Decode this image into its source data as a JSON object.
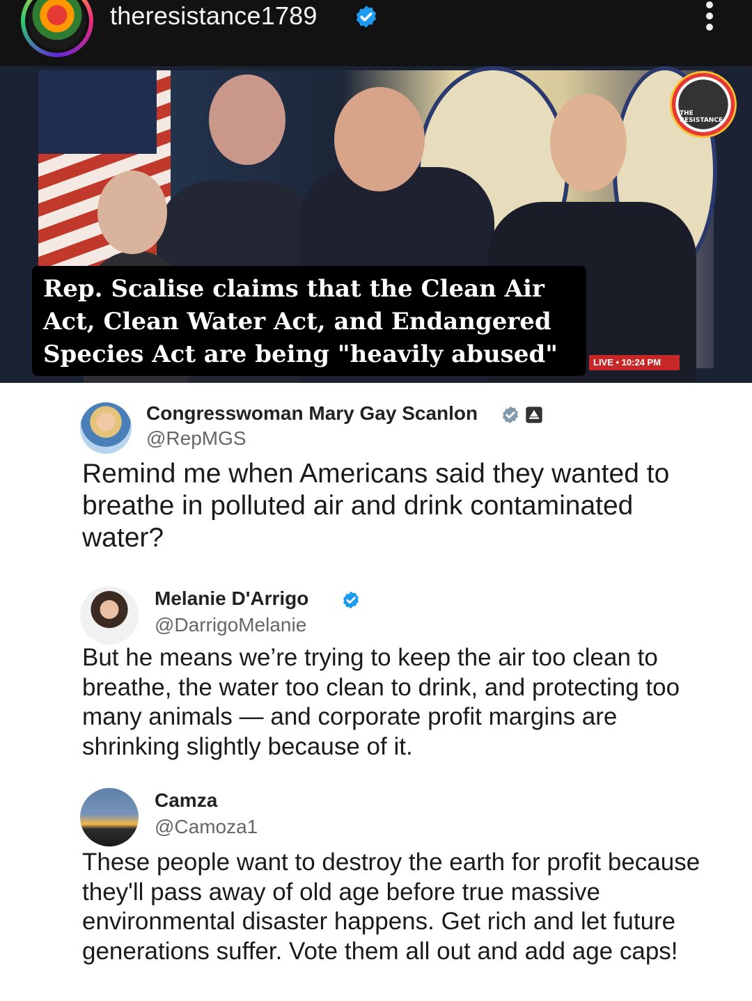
{
  "header": {
    "username": "theresistance1789",
    "verified_icon": "verified-badge-icon",
    "more_icon": "more-vertical-icon"
  },
  "video": {
    "caption": "Rep. Scalise claims that the Clean Air Act, Clean Water Act, and Endangered Species Act are being \"heavily abused\"",
    "live_badge": "LIVE • 10:24 PM",
    "watermark": "THE RESISTANCE"
  },
  "tweets": [
    {
      "name": "Congresswoman Mary Gay Scanlon",
      "handle": "@RepMGS",
      "text": "Remind me when Americans said they wanted to breathe in polluted air and drink contaminated water?"
    },
    {
      "name": "Melanie D'Arrigo",
      "handle": "@DarrigoMelanie",
      "text": "But he means we’re trying to keep the air too clean to breathe, the water too clean to drink, and protecting too many animals — and corporate profit margins are shrinking slightly because of it."
    },
    {
      "name": "Camza",
      "handle": "@Camoza1",
      "text": "These people want to destroy the earth for profit because they'll pass away of old age before true massive environmental disaster happens. Get rich and let future generations suffer. Vote them all out and add age caps!"
    }
  ],
  "colors": {
    "header_bg": "#121212",
    "verified_blue": "#1d9bf0",
    "gov_badge_gray": "#829aab"
  }
}
